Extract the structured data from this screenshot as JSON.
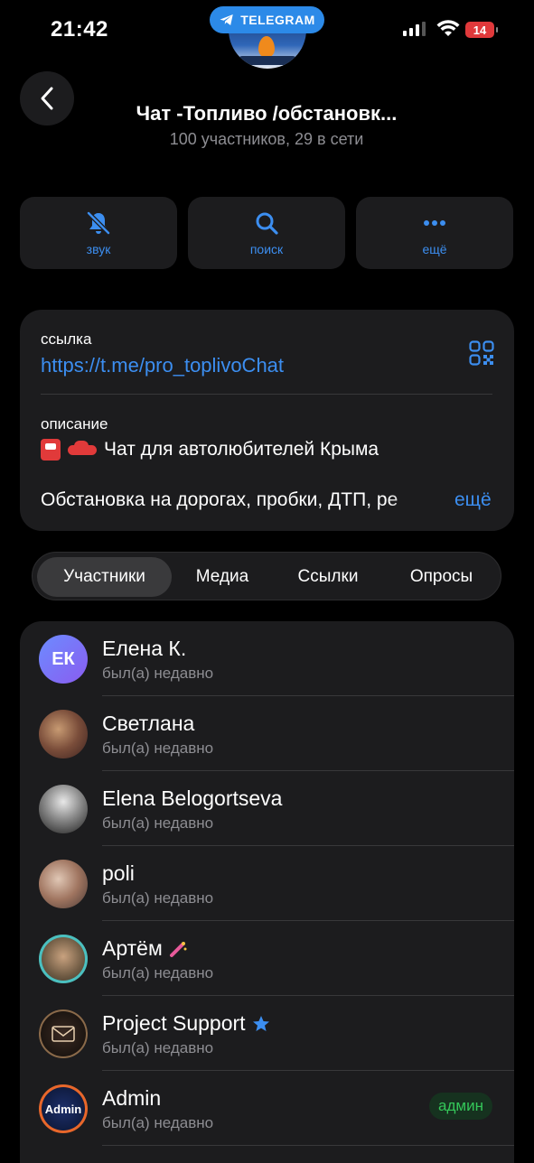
{
  "status_bar": {
    "time": "21:42",
    "app_pill": "TELEGRAM",
    "battery": "14"
  },
  "header": {
    "title": "Чат -Топливо /обстановк...",
    "subtitle": "100 участников, 29 в сети"
  },
  "actions": [
    {
      "label": "звук",
      "icon": "bell-slash-icon"
    },
    {
      "label": "поиск",
      "icon": "search-icon"
    },
    {
      "label": "ещё",
      "icon": "more-icon"
    }
  ],
  "info": {
    "link_label": "ссылка",
    "link_value": "https://t.me/pro_toplivoChat",
    "description_label": "описание",
    "description_line1": "Чат для автолюбителей Крыма",
    "description_line2": "Обстановка на дорогах, пробки, ДТП, ре",
    "more": "ещё"
  },
  "tabs": [
    "Участники",
    "Медиа",
    "Ссылки",
    "Опросы"
  ],
  "members": [
    {
      "name": "Елена К.",
      "status": "был(а) недавно",
      "initials": "ЕК"
    },
    {
      "name": "Светлана",
      "status": "был(а) недавно"
    },
    {
      "name": "Elena Belogortseva",
      "status": "был(а) недавно"
    },
    {
      "name": "poli",
      "status": "был(а) недавно"
    },
    {
      "name": "Артём",
      "status": "был(а) недавно"
    },
    {
      "name": "Project Support",
      "status": "был(а) недавно"
    },
    {
      "name": "Admin",
      "status": "был(а) недавно",
      "badge": "админ",
      "avatar_text": "Admin"
    }
  ],
  "colors": {
    "accent": "#3c8ef0",
    "admin_badge": "#34c759",
    "battery": "#e0393b"
  }
}
